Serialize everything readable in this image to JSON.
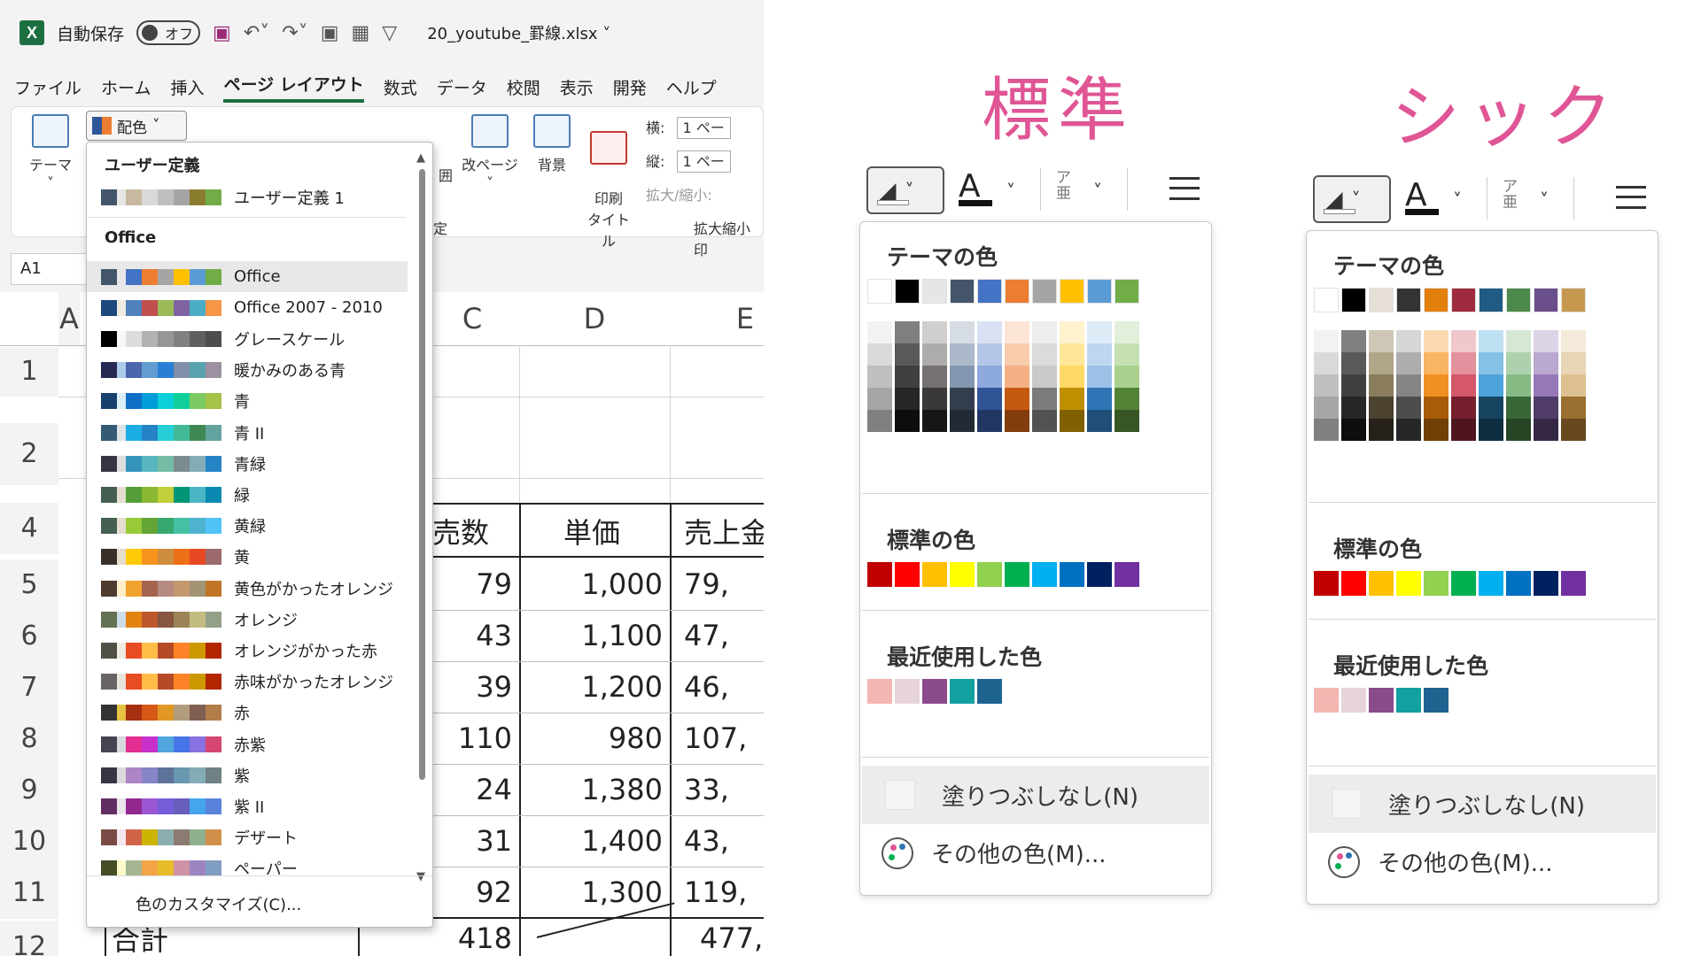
{
  "excel": {
    "qat": {
      "autosave_label": "自動保存",
      "toggle_label": "オフ",
      "file_name": "20_youtube_罫線.xlsx"
    },
    "menu_tabs": [
      "ファイル",
      "ホーム",
      "挿入",
      "ページ レイアウト",
      "数式",
      "データ",
      "校閲",
      "表示",
      "開発",
      "ヘルプ"
    ],
    "ribbon": {
      "theme_label": "テーマ",
      "colors_label": "配色",
      "area_label": "囲",
      "breaks_label": "改ページ",
      "background_label": "背景",
      "print_titles_label": "印刷\nタイトル",
      "width_label": "横:",
      "height_label": "縦:",
      "width_value": "1 ペー",
      "height_value": "1 ペー",
      "scale_label": "拡大/縮小:",
      "group_scale": "拡大縮小印",
      "group_setup": "定"
    },
    "name_box": "A1",
    "columns": [
      "A",
      "C",
      "D",
      "E"
    ],
    "rows": [
      "1",
      "2",
      "4",
      "5",
      "6",
      "7",
      "8",
      "9",
      "10",
      "11",
      "12"
    ],
    "table_header": [
      "売数",
      "単価",
      "売上金"
    ],
    "table_rows": [
      [
        "79",
        "1,000",
        "79,"
      ],
      [
        "43",
        "1,100",
        "47,"
      ],
      [
        "39",
        "1,200",
        "46,"
      ],
      [
        "110",
        "980",
        "107,"
      ],
      [
        "24",
        "1,380",
        "33,"
      ],
      [
        "31",
        "1,400",
        "43,"
      ],
      [
        "92",
        "1,300",
        "119,"
      ]
    ],
    "total_row": {
      "label": "合計",
      "count": "418",
      "sales": "477,"
    },
    "theme_dropdown": {
      "custom_section": "ユーザー定義",
      "custom_item": "ユーザー定義 1",
      "office_section": "Office",
      "customize_label": "色のカスタマイズ(C)...",
      "items": [
        {
          "label": "Office",
          "colors": [
            "#44546a",
            "#e7e6e6",
            "#4472c4",
            "#ed7d31",
            "#a5a5a5",
            "#ffc000",
            "#5b9bd5",
            "#70ad47"
          ]
        },
        {
          "label": "Office 2007 - 2010",
          "colors": [
            "#1f497d",
            "#eeece1",
            "#4f81bd",
            "#c0504d",
            "#9bbb59",
            "#8064a2",
            "#4bacc6",
            "#f79646"
          ]
        },
        {
          "label": "グレースケール",
          "colors": [
            "#000000",
            "#f8f8f8",
            "#dddddd",
            "#b2b2b2",
            "#969696",
            "#808080",
            "#5f5f5f",
            "#4d4d4d"
          ]
        },
        {
          "label": "暖かみのある青",
          "colors": [
            "#242852",
            "#acccea",
            "#4a66ac",
            "#629dd1",
            "#297fd5",
            "#7f8fa9",
            "#5aa2ae",
            "#9d90a0"
          ]
        },
        {
          "label": "青",
          "colors": [
            "#17406d",
            "#dbeff9",
            "#0f6fc6",
            "#009dd9",
            "#0bd0d9",
            "#10cf9b",
            "#7cca62",
            "#a5c249"
          ]
        },
        {
          "label": "青 II",
          "colors": [
            "#335b74",
            "#dfe3e5",
            "#1cade4",
            "#2683c6",
            "#27ced7",
            "#42ba97",
            "#3e8853",
            "#62a39f"
          ]
        },
        {
          "label": "青緑",
          "colors": [
            "#373545",
            "#dedede",
            "#3494ba",
            "#58b6c0",
            "#75bda7",
            "#7a8c8e",
            "#84acb6",
            "#2683c6"
          ]
        },
        {
          "label": "緑",
          "colors": [
            "#455f51",
            "#e3ded1",
            "#549e39",
            "#8ab833",
            "#c0cf3a",
            "#029676",
            "#4ab5c4",
            "#0989b1"
          ]
        },
        {
          "label": "黄緑",
          "colors": [
            "#455f51",
            "#e3ded1",
            "#99cb38",
            "#63a537",
            "#37a76f",
            "#44c1a3",
            "#4eb3cf",
            "#51c3f9"
          ]
        },
        {
          "label": "黄",
          "colors": [
            "#39302a",
            "#e5dec9",
            "#ffca08",
            "#f8931d",
            "#ce8d3e",
            "#ec7016",
            "#e64823",
            "#9c6a6a"
          ]
        },
        {
          "label": "黄色がかったオレンジ",
          "colors": [
            "#4e3b30",
            "#fbeec9",
            "#f0a22e",
            "#a5644e",
            "#b58b80",
            "#c3986d",
            "#a19574",
            "#c17529"
          ]
        },
        {
          "label": "オレンジ",
          "colors": [
            "#637052",
            "#ccddea",
            "#e48312",
            "#bd582c",
            "#865640",
            "#9b8357",
            "#c2bc80",
            "#94a088"
          ]
        },
        {
          "label": "オレンジがかった赤",
          "colors": [
            "#505046",
            "#eeece1",
            "#e84c22",
            "#ffbd47",
            "#b64926",
            "#ff8427",
            "#cc9900",
            "#b22600"
          ]
        },
        {
          "label": "赤味がかったオレンジ",
          "colors": [
            "#696464",
            "#e9e5dc",
            "#e84c22",
            "#ffbd47",
            "#b64926",
            "#ff8427",
            "#cc9900",
            "#b22600"
          ]
        },
        {
          "label": "赤",
          "colors": [
            "#323232",
            "#e5c243",
            "#a5300f",
            "#d55816",
            "#e19825",
            "#b19c7d",
            "#7f5f52",
            "#b27d49"
          ]
        },
        {
          "label": "赤紫",
          "colors": [
            "#454551",
            "#d8d9dc",
            "#e32d91",
            "#c830cc",
            "#4ea6dc",
            "#4775e7",
            "#8971e1",
            "#d54773"
          ]
        },
        {
          "label": "紫",
          "colors": [
            "#373545",
            "#dcd8dc",
            "#ad84c6",
            "#8784c7",
            "#5d739a",
            "#6997af",
            "#84acb6",
            "#6f8183"
          ]
        },
        {
          "label": "紫 II",
          "colors": [
            "#632e62",
            "#eae5eb",
            "#92278f",
            "#9b57d3",
            "#755dd9",
            "#665eb8",
            "#45a5ed",
            "#5982db"
          ]
        },
        {
          "label": "デザート",
          "colors": [
            "#784b47",
            "#f4e7ed",
            "#d16349",
            "#ccb400",
            "#8cadae",
            "#8c7b70",
            "#8fb08c",
            "#d19049"
          ]
        },
        {
          "label": "ペーパー",
          "colors": [
            "#444d26",
            "#fefac9",
            "#a5b592",
            "#f3a447",
            "#e7bc29",
            "#d092a7",
            "#9c85c0",
            "#809ec2"
          ]
        }
      ],
      "custom_colors": [
        "#44546a",
        "#e7e6e6",
        "#c9b8a0",
        "#d9d9d9",
        "#bfbfbf",
        "#a5a5a5",
        "#8a7d2e",
        "#70ad47"
      ]
    }
  },
  "palettes": [
    {
      "title": "標準",
      "theme_header": "テーマの色",
      "standard_header": "標準の色",
      "recent_header": "最近使用した色",
      "no_fill_label": "塗りつぶしなし(N)",
      "more_colors_label": "その他の色(M)...",
      "theme_top": [
        "#ffffff",
        "#000000",
        "#e7e6e6",
        "#44546a",
        "#4472c4",
        "#ed7d31",
        "#a5a5a5",
        "#ffc000",
        "#5b9bd5",
        "#70ad47"
      ],
      "theme_shades": [
        [
          "#f2f2f2",
          "#d9d9d9",
          "#bfbfbf",
          "#a6a6a6",
          "#808080"
        ],
        [
          "#7f7f7f",
          "#595959",
          "#404040",
          "#262626",
          "#0d0d0d"
        ],
        [
          "#d0cece",
          "#aeabab",
          "#757171",
          "#3a3838",
          "#171616"
        ],
        [
          "#d6dce4",
          "#acb9ca",
          "#8497b0",
          "#333f4f",
          "#222a35"
        ],
        [
          "#d9e1f2",
          "#b4c6e7",
          "#8ea9db",
          "#305496",
          "#203764"
        ],
        [
          "#fce4d6",
          "#f8cbad",
          "#f4b084",
          "#c65911",
          "#833c0c"
        ],
        [
          "#ededed",
          "#dbdbdb",
          "#c9c9c9",
          "#7b7b7b",
          "#525252"
        ],
        [
          "#fff2cc",
          "#ffe699",
          "#ffd966",
          "#bf8f00",
          "#806000"
        ],
        [
          "#ddebf7",
          "#bdd7ee",
          "#9bc2e6",
          "#2f75b5",
          "#1f4e78"
        ],
        [
          "#e2efda",
          "#c6e0b4",
          "#a9d08e",
          "#548235",
          "#375623"
        ]
      ],
      "standard": [
        "#c00000",
        "#ff0000",
        "#ffc000",
        "#ffff00",
        "#92d050",
        "#00b050",
        "#00b0f0",
        "#0070c0",
        "#002060",
        "#7030a0"
      ],
      "recent": [
        "#f4b6b0",
        "#e6d3dc",
        "#8b4a8c",
        "#13a0a0",
        "#1f6391"
      ]
    },
    {
      "title": "シック",
      "theme_header": "テーマの色",
      "standard_header": "標準の色",
      "recent_header": "最近使用した色",
      "no_fill_label": "塗りつぶしなし(N)",
      "more_colors_label": "その他の色(M)...",
      "theme_top": [
        "#ffffff",
        "#000000",
        "#e6e0d8",
        "#333333",
        "#e3800d",
        "#9e2b3d",
        "#1f5b82",
        "#4b8a4a",
        "#6b4f8c",
        "#c7984f"
      ],
      "theme_shades": [
        [
          "#f2f2f2",
          "#d9d9d9",
          "#bfbfbf",
          "#a6a6a6",
          "#808080"
        ],
        [
          "#7f7f7f",
          "#595959",
          "#404040",
          "#262626",
          "#0d0d0d"
        ],
        [
          "#cfc7b5",
          "#b2a688",
          "#8a7d5e",
          "#4b422f",
          "#26211a"
        ],
        [
          "#d6d6d6",
          "#adadad",
          "#858585",
          "#4d4d4d",
          "#262626"
        ],
        [
          "#fcd9b1",
          "#f9b464",
          "#f09022",
          "#a85c09",
          "#704006"
        ],
        [
          "#f0c7cd",
          "#e3919c",
          "#d4576a",
          "#761f2d",
          "#4f151e"
        ],
        [
          "#bde0f3",
          "#85c0e6",
          "#4ea3da",
          "#174461",
          "#0f2e41"
        ],
        [
          "#d6e8d5",
          "#aed1ad",
          "#87bb86",
          "#386737",
          "#254525"
        ],
        [
          "#dcd3e6",
          "#b9a8cf",
          "#9678b8",
          "#503c69",
          "#352846"
        ],
        [
          "#f3ead9",
          "#e8d5b4",
          "#ddc08f",
          "#9a6e2e",
          "#67491f"
        ]
      ],
      "standard": [
        "#c00000",
        "#ff0000",
        "#ffc000",
        "#ffff00",
        "#92d050",
        "#00b050",
        "#00b0f0",
        "#0070c0",
        "#002060",
        "#7030a0"
      ],
      "recent": [
        "#f4b6b0",
        "#e6d3dc",
        "#8b4a8c",
        "#13a0a0",
        "#1f6391"
      ]
    }
  ]
}
